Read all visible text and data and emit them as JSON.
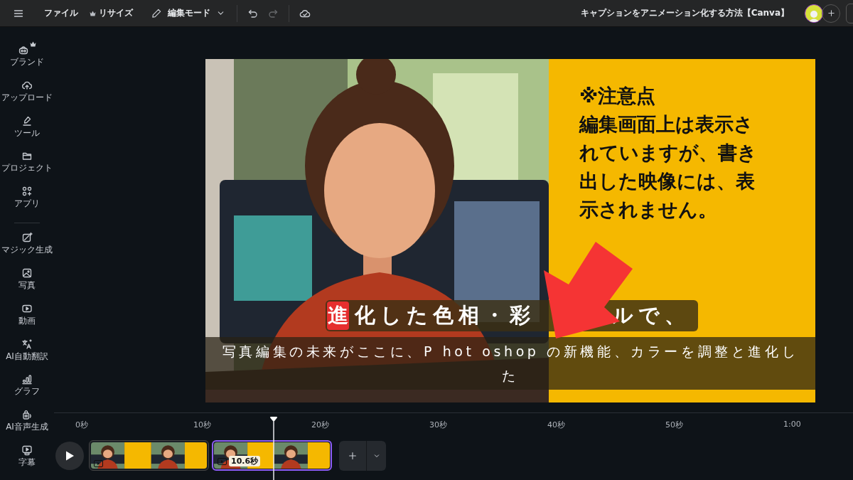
{
  "toolbar": {
    "menu_items": [
      {
        "label": "ファイル",
        "premium": false
      },
      {
        "label": "リサイズ",
        "premium": true
      }
    ],
    "mode": "編集モード",
    "undo": {
      "disabled": false
    },
    "redo": {
      "disabled": true
    },
    "title": "キャプションをアニメーション化する方法【Canva】"
  },
  "sidebar": {
    "groups": [
      [
        {
          "label": "ブランド",
          "kind": "brand",
          "premium": true
        },
        {
          "label": "アップロード",
          "kind": "upload",
          "premium": false
        },
        {
          "label": "ツール",
          "kind": "tools",
          "premium": false
        },
        {
          "label": "プロジェクト",
          "kind": "folder",
          "premium": false
        },
        {
          "label": "アプリ",
          "kind": "apps",
          "premium": false
        }
      ],
      [
        {
          "label": "マジック生成",
          "kind": "magic",
          "premium": false
        },
        {
          "label": "写真",
          "premium": false
        },
        {
          "label": "動画",
          "kind": "video",
          "premium": false
        },
        {
          "label": "AI自動翻訳",
          "kind": "translate",
          "premium": false
        },
        {
          "label": "グラフ",
          "kind": "graph",
          "premium": false
        },
        {
          "label": "AI音声生成",
          "kind": "voice",
          "premium": false
        },
        {
          "label": "字幕",
          "kind": "subtitle",
          "premium": false
        }
      ]
    ]
  },
  "slide": {
    "note_lines": [
      "※注意点",
      "編集画面上は表示さ",
      "れていますが、書き",
      "出した映像には、表",
      "示されません。"
    ],
    "caption_1": {
      "highlight": "進",
      "parts": [
        "化した色相・彩",
        "ルで、"
      ]
    },
    "caption_2": {
      "lines": [
        "写真編集の未来がここに、P hot oshop の新機能、カラーを調整と進化し",
        "た"
      ]
    }
  },
  "timeline": {
    "ruler": [
      "0秒",
      "10秒",
      "20秒",
      "30秒",
      "40秒",
      "50秒",
      "1:00"
    ],
    "clips": [
      {
        "selected": false
      },
      {
        "selected": true,
        "duration": "10.6秒"
      }
    ]
  }
}
